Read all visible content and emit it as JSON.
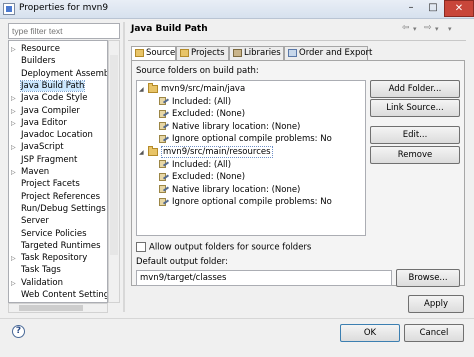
{
  "window": {
    "title": "Properties for mvn9",
    "min_glyph": "–",
    "max_glyph": "□",
    "close_glyph": "✕"
  },
  "filter": {
    "placeholder": "type filter text"
  },
  "nav": {
    "items": [
      {
        "label": "Resource",
        "expandable": true
      },
      {
        "label": "Builders",
        "expandable": false
      },
      {
        "label": "Deployment Assembly",
        "expandable": false
      },
      {
        "label": "Java Build Path",
        "expandable": false,
        "selected": true
      },
      {
        "label": "Java Code Style",
        "expandable": true
      },
      {
        "label": "Java Compiler",
        "expandable": true
      },
      {
        "label": "Java Editor",
        "expandable": true
      },
      {
        "label": "Javadoc Location",
        "expandable": false
      },
      {
        "label": "JavaScript",
        "expandable": true
      },
      {
        "label": "JSP Fragment",
        "expandable": false
      },
      {
        "label": "Maven",
        "expandable": true
      },
      {
        "label": "Project Facets",
        "expandable": false
      },
      {
        "label": "Project References",
        "expandable": false
      },
      {
        "label": "Run/Debug Settings",
        "expandable": false
      },
      {
        "label": "Server",
        "expandable": false
      },
      {
        "label": "Service Policies",
        "expandable": false
      },
      {
        "label": "Targeted Runtimes",
        "expandable": false
      },
      {
        "label": "Task Repository",
        "expandable": true
      },
      {
        "label": "Task Tags",
        "expandable": false
      },
      {
        "label": "Validation",
        "expandable": true
      },
      {
        "label": "Web Content Settings",
        "expandable": false
      }
    ]
  },
  "page": {
    "title": "Java Build Path",
    "back_glyph": "⇦",
    "back_menu_glyph": "▾",
    "forward_glyph": "⇨",
    "forward_menu_glyph": "▾",
    "menu_glyph": "▾"
  },
  "tabs": [
    {
      "label": "Source",
      "active": true
    },
    {
      "label": "Projects",
      "active": false
    },
    {
      "label": "Libraries",
      "active": false
    },
    {
      "label": "Order and Export",
      "active": false
    }
  ],
  "source": {
    "label": "Source folders on build path:",
    "tree": [
      {
        "label": "mvn9/src/main/java",
        "level": 0,
        "kind": "folder",
        "twisty": "◢"
      },
      {
        "label": "Included: (All)",
        "level": 1,
        "kind": "prop"
      },
      {
        "label": "Excluded: (None)",
        "level": 1,
        "kind": "prop"
      },
      {
        "label": "Native library location: (None)",
        "level": 1,
        "kind": "prop"
      },
      {
        "label": "Ignore optional compile problems: No",
        "level": 1,
        "kind": "prop"
      },
      {
        "label": "mvn9/src/main/resources",
        "level": 0,
        "kind": "folder",
        "twisty": "◢",
        "selected": true
      },
      {
        "label": "Included: (All)",
        "level": 1,
        "kind": "prop"
      },
      {
        "label": "Excluded: (None)",
        "level": 1,
        "kind": "prop"
      },
      {
        "label": "Native library location: (None)",
        "level": 1,
        "kind": "prop"
      },
      {
        "label": "Ignore optional compile problems: No",
        "level": 1,
        "kind": "prop"
      }
    ],
    "buttons": {
      "add_folder": "Add Folder...",
      "link_source": "Link Source...",
      "edit": "Edit...",
      "remove": "Remove"
    },
    "allow_output_label": "Allow output folders for source folders",
    "allow_output_checked": false,
    "default_output_label": "Default output folder:",
    "default_output_value": "mvn9/target/classes",
    "browse": "Browse..."
  },
  "footer": {
    "apply": "Apply",
    "help": "?",
    "ok": "OK",
    "cancel": "Cancel"
  }
}
